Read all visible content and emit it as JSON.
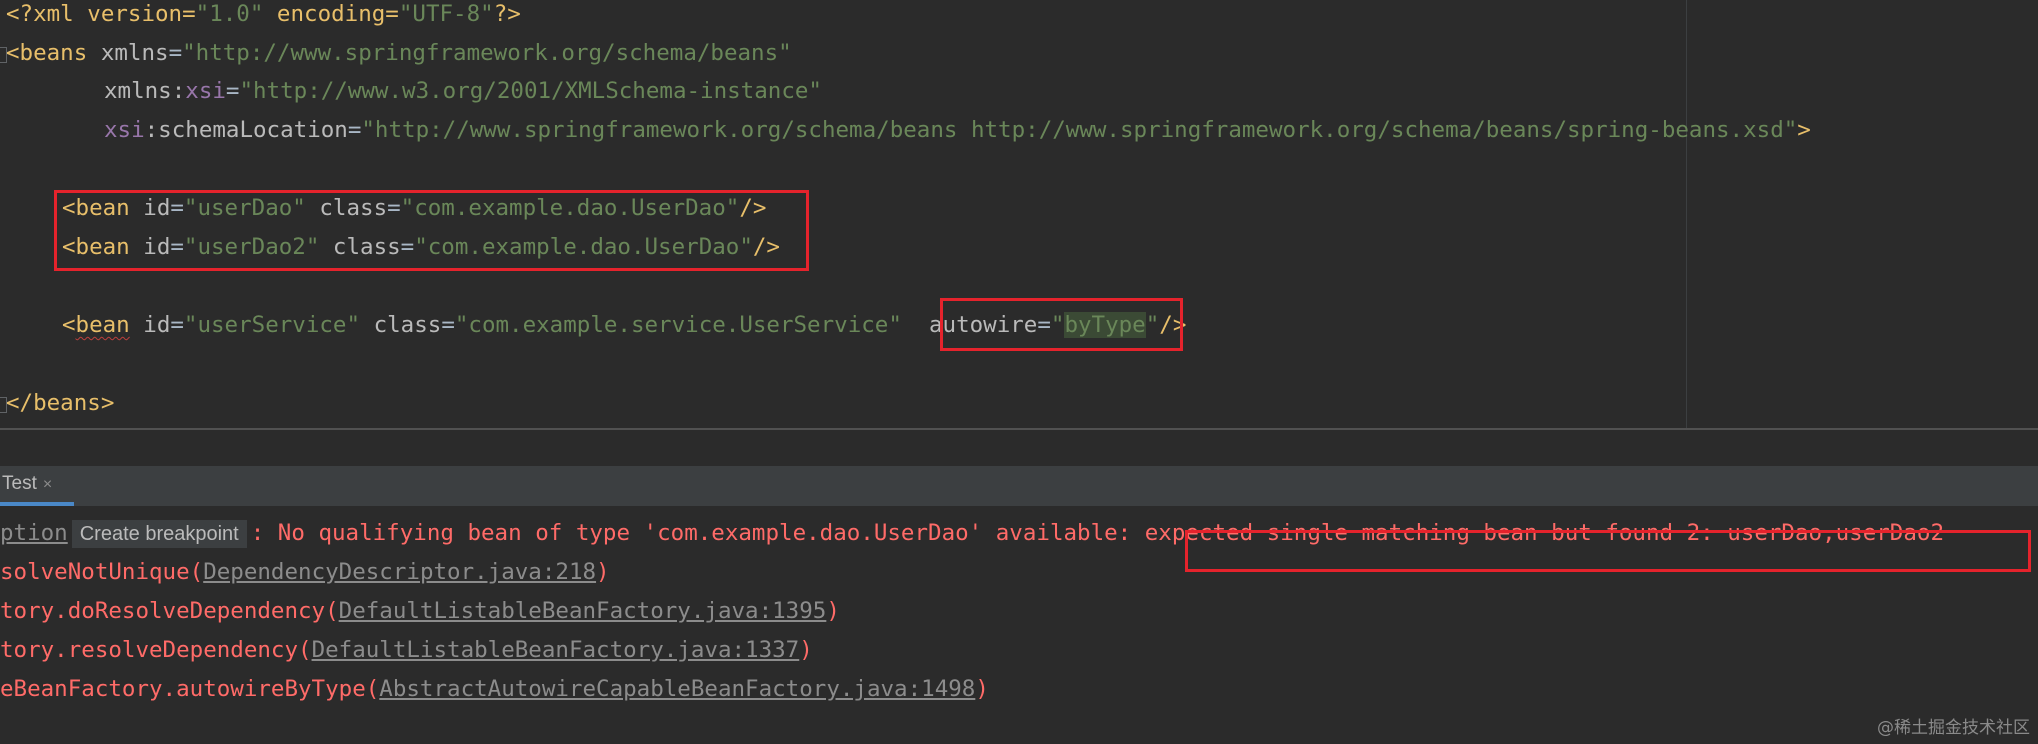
{
  "editor": {
    "lines": {
      "xml_decl": [
        "<?xml version=",
        "\"1.0\"",
        " encoding=",
        "\"UTF-8\"",
        "?>"
      ],
      "beans_open_tag": "<beans",
      "beans_xmlns_attr": " xmlns",
      "beans_xmlns_eq": "=",
      "beans_xmlns_val": "\"http://www.springframework.org/schema/beans\"",
      "xsi_ns_prefix": "xmlns:",
      "xsi_ns_name": "xsi",
      "xsi_ns_eq": "=",
      "xsi_ns_val": "\"http://www.w3.org/2001/XMLSchema-instance\"",
      "schema_prefix": "xsi",
      "schema_attr": ":schemaLocation",
      "schema_eq": "=",
      "schema_val": "\"http://www.springframework.org/schema/beans http://www.springframework.org/schema/beans/spring-beans.xsd\"",
      "schema_close": ">",
      "bean1": {
        "open": "<bean",
        "id_attr": " id",
        "eq": "=",
        "id_val": "\"userDao\"",
        "class_attr": " class",
        "class_val": "\"com.example.dao.UserDao\"",
        "close": "/>"
      },
      "bean2": {
        "open": "<bean",
        "id_attr": " id",
        "eq": "=",
        "id_val": "\"userDao2\"",
        "class_attr": " class",
        "class_val": "\"com.example.dao.UserDao\"",
        "close": "/>"
      },
      "bean3": {
        "open_lt": "<",
        "open_name": "bean",
        "id_attr": " id",
        "eq": "=",
        "id_val": "\"userService\"",
        "class_attr": " class",
        "class_val": "\"com.example.service.UserService\"",
        "autowire_attr": "autowire",
        "autowire_quote_l": "\"",
        "autowire_val": "byType",
        "autowire_quote_r": "\"",
        "close": "/>"
      },
      "beans_close": "</beans>"
    }
  },
  "run_panel": {
    "tab_label": "Test",
    "tab_close": "×"
  },
  "console": {
    "line1_prefix": "ption",
    "line1_hint": "Create breakpoint",
    "line1_msg": ": No qualifying bean of type 'com.example.dao.UserDao' available: ",
    "line1_highlight": "expected single matching bean but found 2: userDao,userDao2",
    "line2_method": "solveNotUnique(",
    "line2_link": "DependencyDescriptor.java:218",
    "line2_end": ")",
    "line3_method": "tory.doResolveDependency(",
    "line3_link": "DefaultListableBeanFactory.java:1395",
    "line3_end": ")",
    "line4_method": "tory.resolveDependency(",
    "line4_link": "DefaultListableBeanFactory.java:1337",
    "line4_end": ")",
    "line5_method": "eBeanFactory.autowireByType(",
    "line5_link": "AbstractAutowireCapableBeanFactory.java:1498",
    "line5_end": ")"
  },
  "watermark": "@稀土掘金技术社区"
}
